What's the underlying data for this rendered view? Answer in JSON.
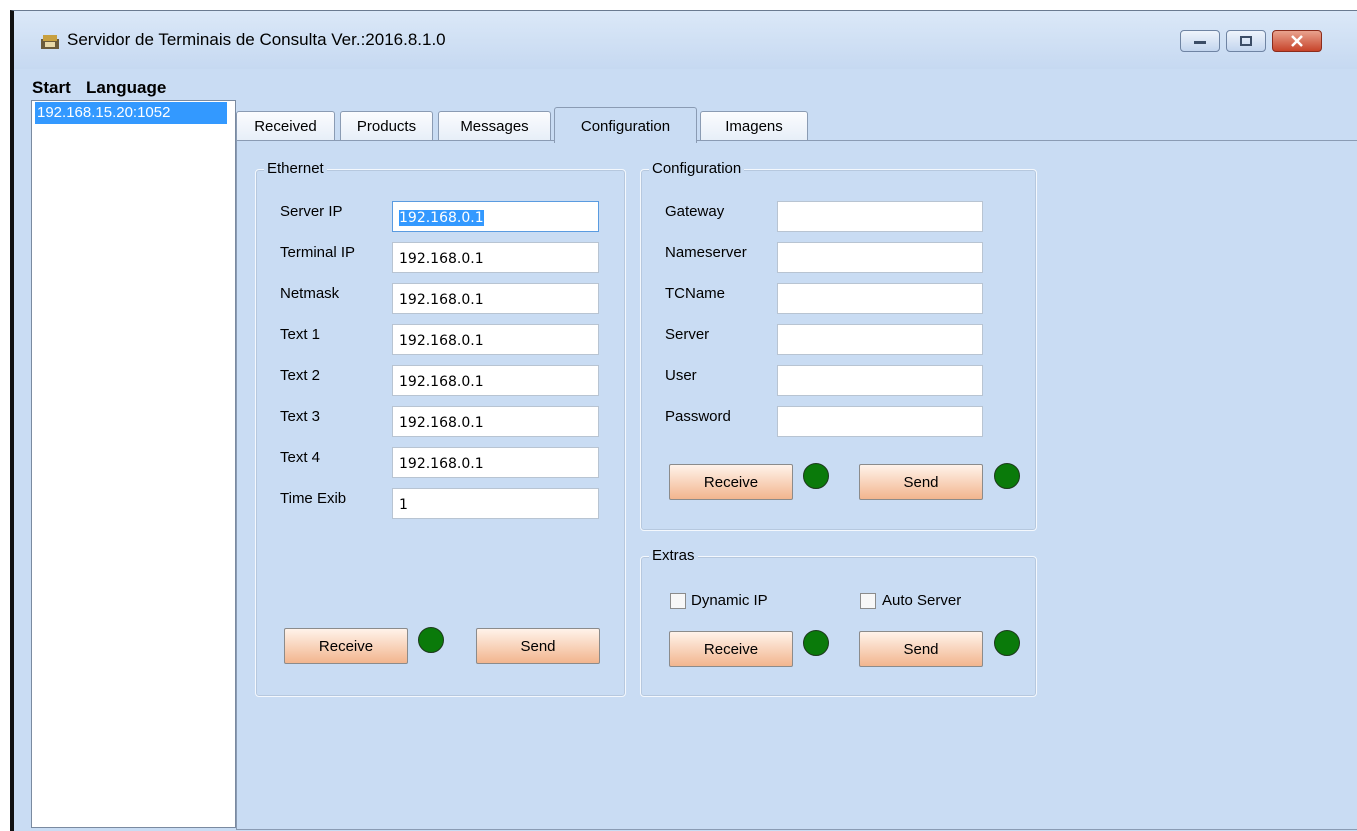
{
  "window": {
    "title": "Servidor de Terminais de Consulta Ver.:2016.8.1.0",
    "controls": [
      "minimize",
      "maximize",
      "close"
    ]
  },
  "menu": {
    "items": [
      "Start",
      "Language"
    ]
  },
  "connections": {
    "items": [
      "192.168.15.20:1052"
    ],
    "selected_index": 0
  },
  "tabs": {
    "items": [
      "Received",
      "Products",
      "Messages",
      "Configuration",
      "Imagens"
    ],
    "active": "Configuration"
  },
  "ethernet": {
    "title": "Ethernet",
    "fields": [
      {
        "label": "Server IP",
        "value": "192.168.0.1",
        "selected": true
      },
      {
        "label": "Terminal IP",
        "value": "192.168.0.1"
      },
      {
        "label": "Netmask",
        "value": "192.168.0.1"
      },
      {
        "label": "Text 1",
        "value": "192.168.0.1"
      },
      {
        "label": "Text 2",
        "value": "192.168.0.1"
      },
      {
        "label": "Text 3",
        "value": "192.168.0.1"
      },
      {
        "label": "Text 4",
        "value": "192.168.0.1"
      },
      {
        "label": "Time Exib",
        "value": "1"
      }
    ],
    "receive_label": "Receive",
    "send_label": "Send"
  },
  "configuration": {
    "title": "Configuration",
    "fields": [
      {
        "label": "Gateway",
        "value": ""
      },
      {
        "label": "Nameserver",
        "value": ""
      },
      {
        "label": "TCName",
        "value": ""
      },
      {
        "label": "Server",
        "value": ""
      },
      {
        "label": "User",
        "value": ""
      },
      {
        "label": "Password",
        "value": ""
      }
    ],
    "receive_label": "Receive",
    "send_label": "Send"
  },
  "extras": {
    "title": "Extras",
    "dynamic_ip_label": "Dynamic IP",
    "dynamic_ip_checked": false,
    "auto_server_label": "Auto Server",
    "auto_server_checked": false,
    "receive_label": "Receive",
    "send_label": "Send"
  },
  "colors": {
    "window_bg": "#c9dcf3",
    "selection": "#3399ff",
    "button_gradient_bottom": "#f2b58e",
    "status_led": "#0a7a0a"
  }
}
